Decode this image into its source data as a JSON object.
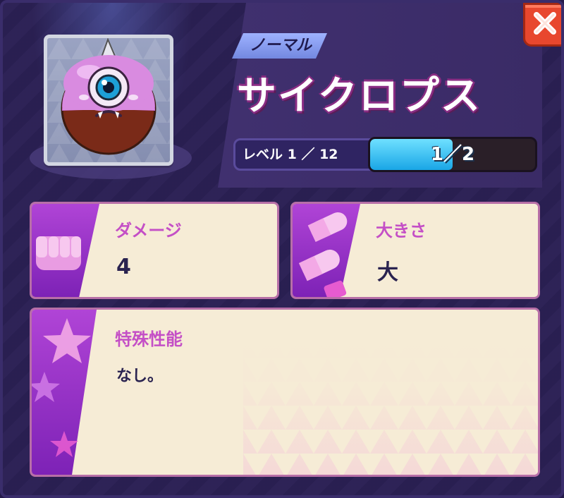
{
  "rank": {
    "label": "ノーマル"
  },
  "monster": {
    "name": "サイクロプス"
  },
  "level": {
    "label": "レベル 1 ／ 12"
  },
  "progress": {
    "text": "1／2",
    "fraction": 0.5
  },
  "stats": {
    "damage": {
      "title": "ダメージ",
      "value": "4"
    },
    "size": {
      "title": "大きさ",
      "value": "大"
    }
  },
  "special": {
    "title": "特殊性能",
    "text": "なし。"
  },
  "icons": {
    "close": "close-icon",
    "fist": "fist-icon",
    "bullets": "bullet-icon",
    "stars": "star-icon"
  },
  "colors": {
    "accent_purple": "#8e2fc4",
    "title_pink": "#c44fc6",
    "progress_blue": "#19a6e6",
    "close_red": "#e8472e"
  }
}
